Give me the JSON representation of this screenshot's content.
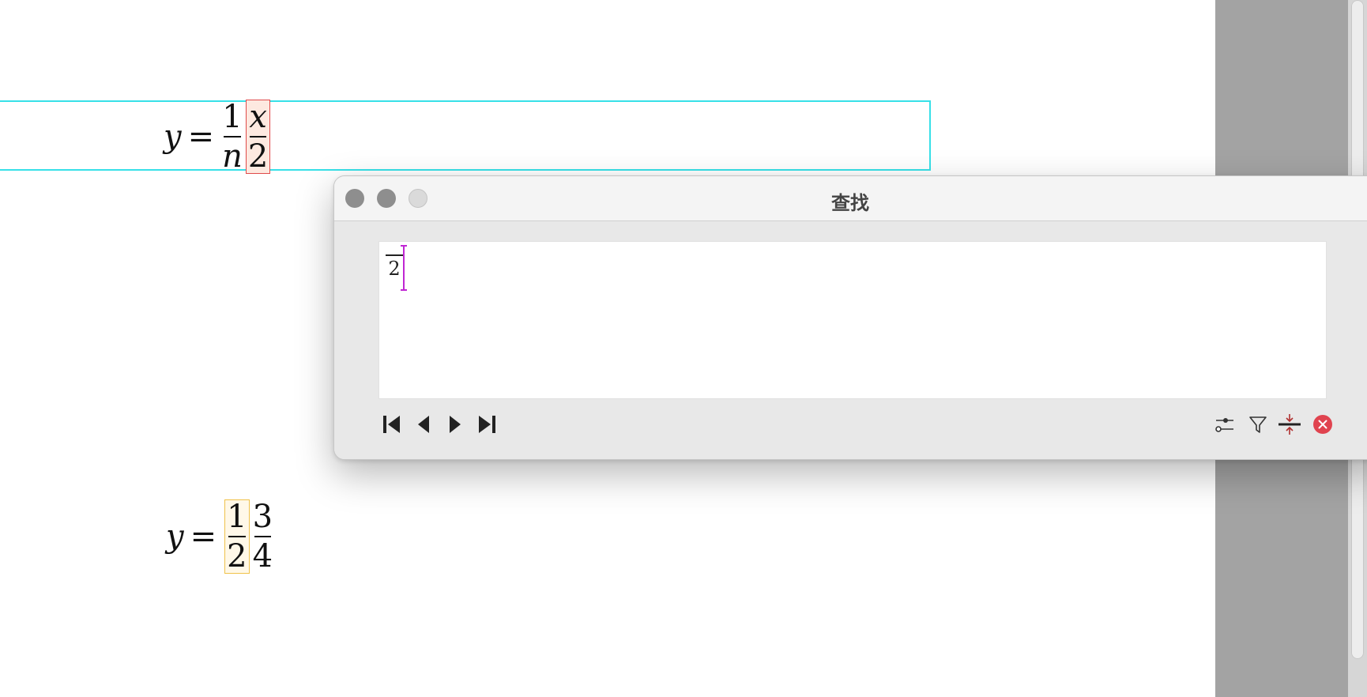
{
  "dialog": {
    "title": "查找",
    "query": {
      "denominator": "2"
    },
    "nav_icons": [
      "first-result-icon",
      "previous-result-icon",
      "next-result-icon",
      "last-result-icon"
    ],
    "tool_icons": [
      "options-icon",
      "filter-icon",
      "match-selection-icon",
      "close-icon"
    ]
  },
  "equations": {
    "first": {
      "lhs": "y",
      "eq": "=",
      "frac1_num": "1",
      "frac1_den": "n",
      "frac2_num": "x",
      "frac2_den": "2"
    },
    "second": {
      "lhs": "y",
      "eq": "=",
      "frac1_num": "1",
      "frac1_den": "2",
      "frac2_num": "3",
      "frac2_den": "4"
    }
  },
  "colors": {
    "selection_box": "#37e0e8",
    "match_highlight": "#e04a4a",
    "secondary_match": "#f0c24a",
    "caret": "#c026d3",
    "close_button": "#e0434f"
  }
}
